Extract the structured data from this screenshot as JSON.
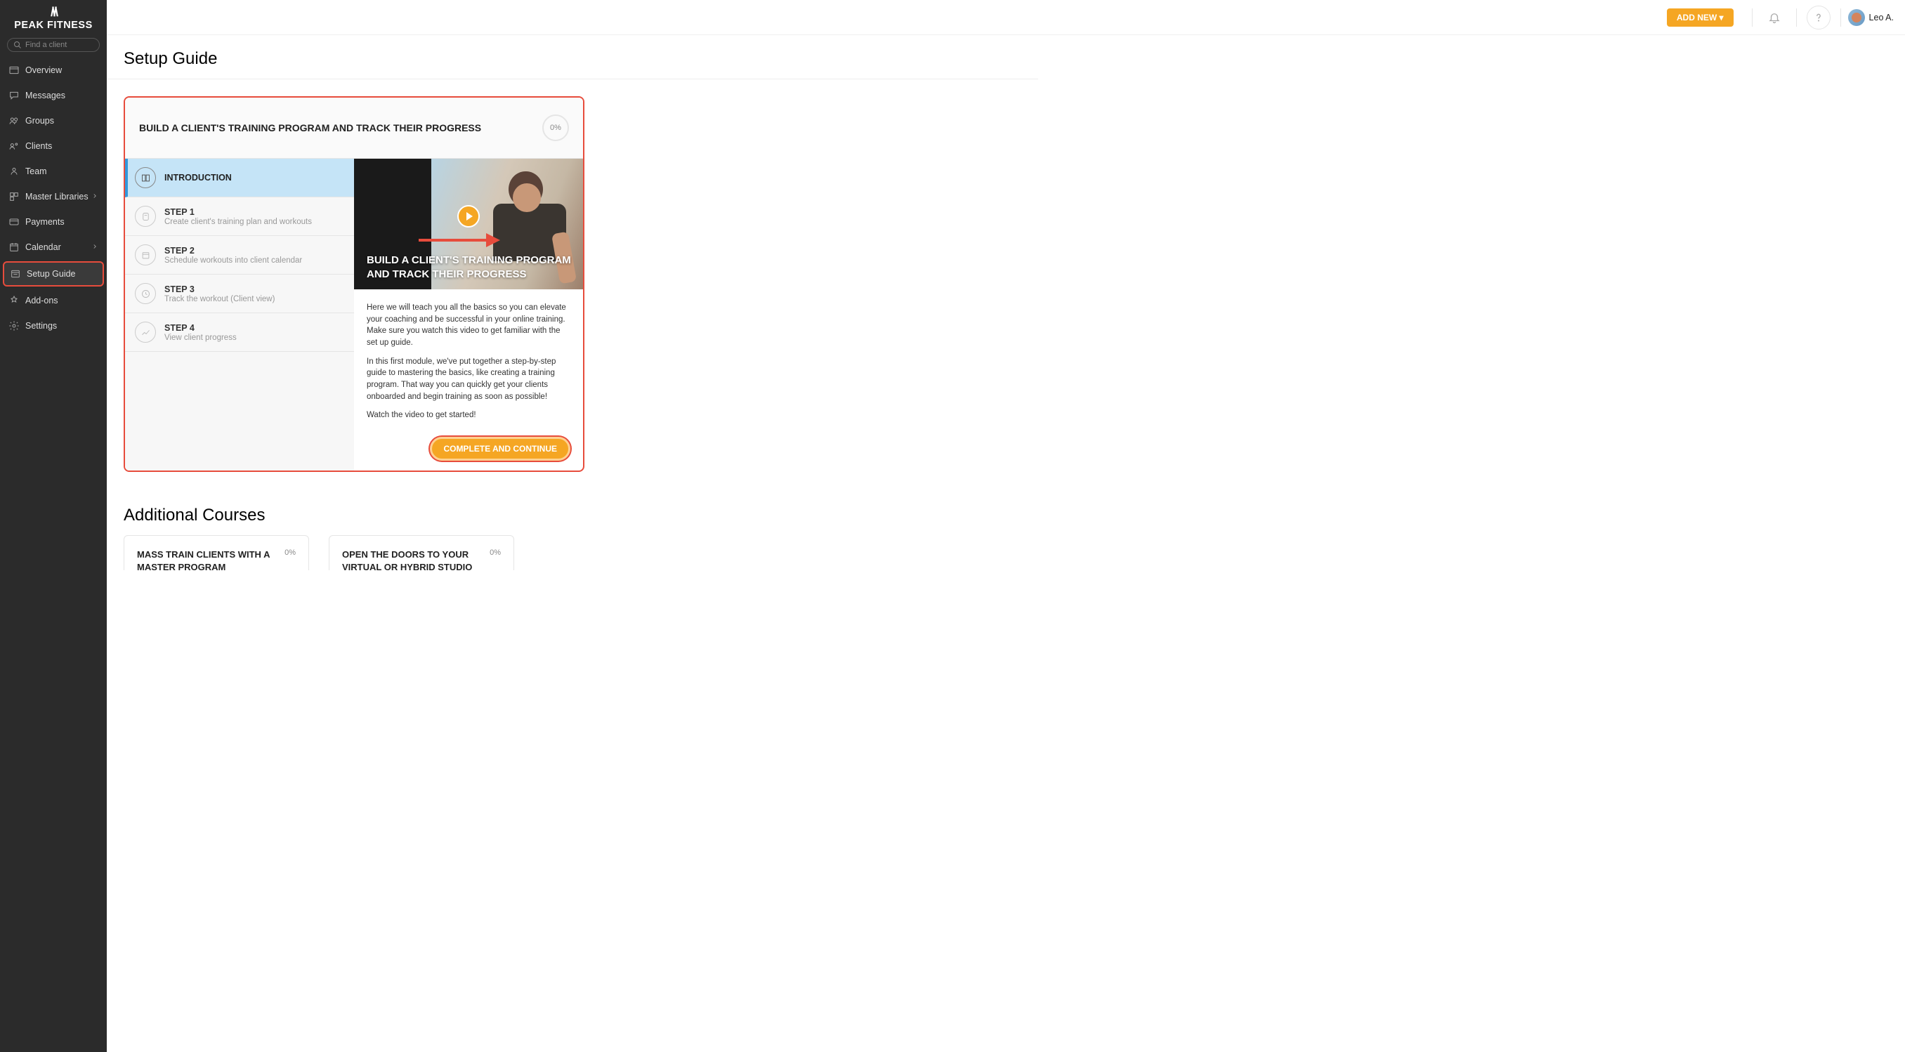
{
  "brand": {
    "name": "PEAK FITNESS"
  },
  "search": {
    "placeholder": "Find a client"
  },
  "nav": [
    {
      "label": "Overview"
    },
    {
      "label": "Messages"
    },
    {
      "label": "Groups"
    },
    {
      "label": "Clients"
    },
    {
      "label": "Team"
    },
    {
      "label": "Master Libraries",
      "chevron": true
    },
    {
      "label": "Payments"
    },
    {
      "label": "Calendar",
      "chevron": true
    },
    {
      "label": "Setup Guide",
      "active": true
    },
    {
      "label": "Add-ons"
    },
    {
      "label": "Settings"
    }
  ],
  "topbar": {
    "addNew": "ADD NEW  ▾",
    "userName": "Leo A."
  },
  "page": {
    "title": "Setup Guide",
    "additionalTitle": "Additional Courses"
  },
  "course": {
    "title": "BUILD A CLIENT'S TRAINING PROGRAM AND TRACK THEIR PROGRESS",
    "progress": "0%",
    "steps": [
      {
        "label": "INTRODUCTION",
        "sublabel": "",
        "active": true
      },
      {
        "label": "STEP 1",
        "sublabel": "Create client's training plan and workouts"
      },
      {
        "label": "STEP 2",
        "sublabel": "Schedule workouts into client calendar"
      },
      {
        "label": "STEP 3",
        "sublabel": "Track the workout (Client view)"
      },
      {
        "label": "STEP 4",
        "sublabel": "View client progress"
      }
    ],
    "videoTitle": "BUILD A CLIENT'S TRAINING PROGRAM AND TRACK THEIR PROGRESS",
    "para1": "Here we will teach you all the basics so you can elevate your coaching and be successful in your online training. Make sure you watch this video to get familiar with the set up guide.",
    "para2": "In this first module, we've put together a step-by-step guide to mastering the basics, like creating a training program. That way you can quickly get your clients onboarded and begin training as soon as possible!",
    "para3": "Watch the video to get started!",
    "continueLabel": "COMPLETE AND CONTINUE"
  },
  "additionalCourses": [
    {
      "title": "MASS TRAIN CLIENTS WITH A MASTER PROGRAM",
      "progress": "0%"
    },
    {
      "title": "OPEN THE DOORS TO YOUR VIRTUAL OR HYBRID STUDIO",
      "progress": "0%"
    }
  ]
}
